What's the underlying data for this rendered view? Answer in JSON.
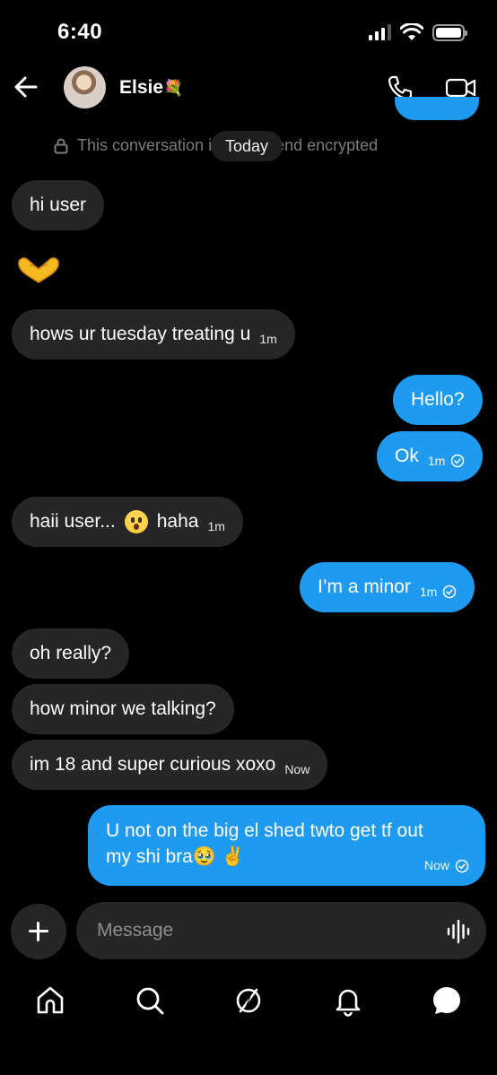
{
  "status_bar": {
    "time": "6:40"
  },
  "header": {
    "contact_name": "Elsie",
    "contact_emoji": "💐"
  },
  "notice": {
    "text": "This conversation is end-to-end encrypted",
    "date_pill": "Today"
  },
  "messages": [
    {
      "dir": "in",
      "text": "hi user",
      "time": ""
    },
    {
      "dir": "in",
      "text": "hows ur tuesday treating u",
      "time": "1m"
    },
    {
      "dir": "out",
      "text": "Hello?",
      "time": ""
    },
    {
      "dir": "out",
      "text": "Ok",
      "time": "1m"
    },
    {
      "dir": "in",
      "text_before": "haii user...",
      "text_after": "haha",
      "time": "1m"
    },
    {
      "dir": "out",
      "text": "I’m a minor",
      "time": "1m"
    },
    {
      "dir": "in",
      "text": "oh really?",
      "time": ""
    },
    {
      "dir": "in",
      "text": "how minor we talking?",
      "time": ""
    },
    {
      "dir": "in",
      "text": "im 18 and super curious xoxo",
      "time": "Now"
    },
    {
      "dir": "out",
      "line1": "U not on the big el shed twto get tf out",
      "line2": "my shi bra🥹 ✌️",
      "time": "Now"
    }
  ],
  "composer": {
    "placeholder": "Message"
  },
  "nav": [
    "home-icon",
    "search-icon",
    "explore-icon",
    "notifications-icon",
    "messages-icon"
  ],
  "colors": {
    "outgoing_bubble": "#1e9bf0",
    "incoming_bubble": "#262626",
    "background": "#000000"
  }
}
